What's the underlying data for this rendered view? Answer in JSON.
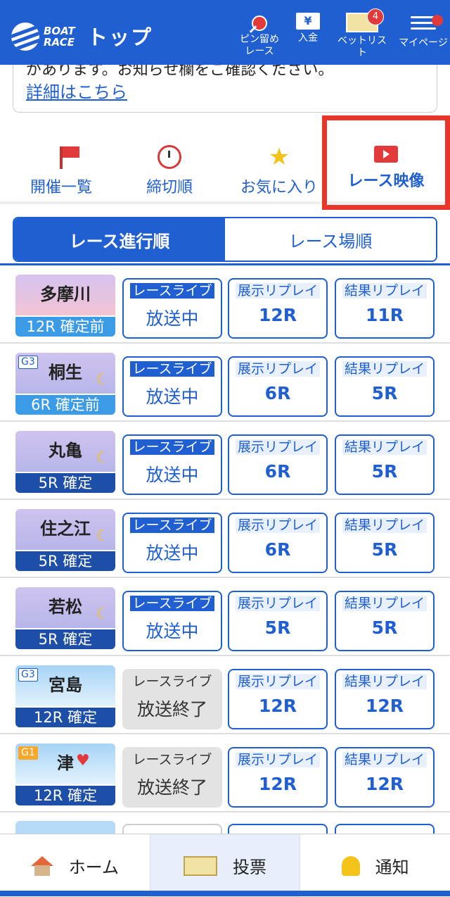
{
  "header": {
    "logo_text_line1": "BOAT",
    "logo_text_line2": "RACE",
    "title": "トップ",
    "buttons": [
      {
        "label_line1": "ピン留め",
        "label_line2": "レース",
        "icon": "pin-icon"
      },
      {
        "label_line1": "入金",
        "icon": "yen-icon",
        "glyph": "¥"
      },
      {
        "label_line1": "ベットリスト",
        "icon": "ticket-icon",
        "badge": "4"
      },
      {
        "label_line1": "マイページ",
        "icon": "menu-icon"
      }
    ]
  },
  "notice": {
    "text": "があります。お知らせ欄をご確認ください。",
    "link": "詳細はこちら"
  },
  "tabs": [
    {
      "label": "開催一覧",
      "icon": "flag-icon"
    },
    {
      "label": "締切順",
      "icon": "alarm-clock-icon"
    },
    {
      "label": "お気に入り",
      "icon": "star-icon",
      "glyph": "★"
    },
    {
      "label": "レース映像",
      "icon": "video-icon",
      "active": true
    }
  ],
  "segment": {
    "on": "レース進行順",
    "off": "レース場順"
  },
  "labels": {
    "live": "レースライブ",
    "preview": "展示リプレイ",
    "result": "結果リプレイ"
  },
  "races": [
    {
      "venue": "多摩川",
      "grade": "",
      "status": "12R 確定前",
      "live": "放送中",
      "preview": "12R",
      "result": "11R"
    },
    {
      "venue": "桐生",
      "grade": "G3",
      "status": "6R 確定前",
      "live": "放送中",
      "preview": "6R",
      "result": "5R"
    },
    {
      "venue": "丸亀",
      "grade": "",
      "status": "5R 確定",
      "live": "放送中",
      "preview": "6R",
      "result": "5R"
    },
    {
      "venue": "住之江",
      "grade": "",
      "status": "5R 確定",
      "live": "放送中",
      "preview": "6R",
      "result": "5R"
    },
    {
      "venue": "若松",
      "grade": "",
      "status": "5R 確定",
      "live": "放送中",
      "preview": "5R",
      "result": "5R"
    },
    {
      "venue": "宮島",
      "grade": "G3",
      "status": "12R 確定",
      "live": "放送終了",
      "preview": "12R",
      "result": "12R"
    },
    {
      "venue": "津",
      "grade": "G1",
      "status": "12R 確定",
      "live": "放送終了",
      "preview": "12R",
      "result": "12R"
    }
  ],
  "bottom_nav": [
    {
      "label": "ホーム",
      "icon": "home-icon"
    },
    {
      "label": "投票",
      "icon": "bet-slip-icon"
    },
    {
      "label": "通知",
      "icon": "bell-icon"
    }
  ],
  "colors": {
    "brand": "#1f5fd1",
    "highlight": "#e8362b",
    "live_chip": "#1f5fd1",
    "ended": "#e3e3e3"
  }
}
